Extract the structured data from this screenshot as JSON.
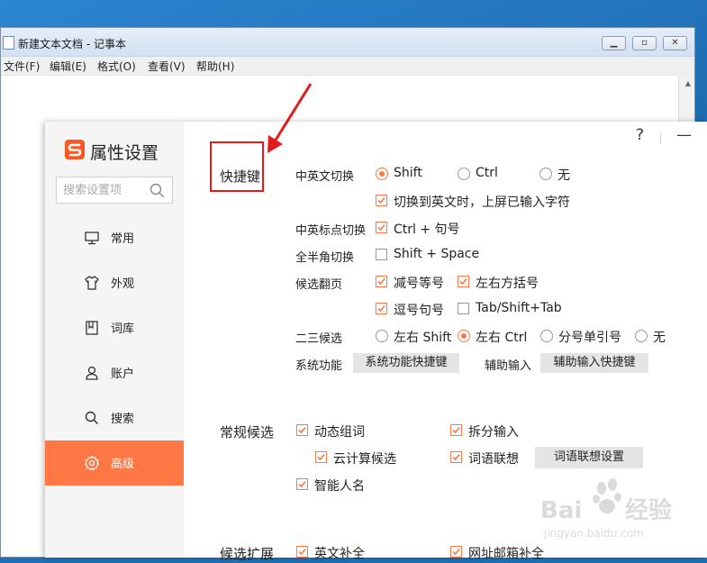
{
  "notepad": {
    "title": "新建文本文档 - 记事本",
    "menus": [
      "文件(F)",
      "编辑(E)",
      "格式(O)",
      "查看(V)",
      "帮助(H)"
    ]
  },
  "dialog": {
    "title": "属性设置",
    "search_placeholder": "搜索设置项",
    "help": "?",
    "minimize": "—",
    "nav": [
      {
        "label": "常用",
        "icon": "monitor-icon"
      },
      {
        "label": "外观",
        "icon": "shirt-icon"
      },
      {
        "label": "词库",
        "icon": "bookmark-icon"
      },
      {
        "label": "账户",
        "icon": "user-icon"
      },
      {
        "label": "搜索",
        "icon": "search-icon"
      },
      {
        "label": "高级",
        "icon": "gear-icon",
        "active": true
      }
    ]
  },
  "shortcuts": {
    "title": "快捷键",
    "cn_en_switch": {
      "label": "中英文切换",
      "options": [
        "Shift",
        "Ctrl",
        "无"
      ],
      "selected": "Shift",
      "commit_label": "切换到英文时，上屏已输入字符",
      "commit_checked": true
    },
    "punct_switch": {
      "label": "中英标点切换",
      "option": "Ctrl + 句号",
      "checked": true
    },
    "width_switch": {
      "label": "全半角切换",
      "option": "Shift + Space",
      "checked": false
    },
    "page_turn": {
      "label": "候选翻页",
      "options": [
        {
          "label": "减号等号",
          "checked": true
        },
        {
          "label": "左右方括号",
          "checked": true
        },
        {
          "label": "逗号句号",
          "checked": true
        },
        {
          "label": "Tab/Shift+Tab",
          "checked": false
        }
      ]
    },
    "second_third": {
      "label": "二三候选",
      "options": [
        "左右 Shift",
        "左右 Ctrl",
        "分号单引号",
        "无"
      ],
      "selected": "左右 Ctrl"
    },
    "system": {
      "label": "系统功能",
      "button": "系统功能快捷键"
    },
    "assist": {
      "label": "辅助输入",
      "button": "辅助输入快捷键"
    }
  },
  "candidates": {
    "title": "常规候选",
    "dynamic": "动态组词",
    "split": "拆分输入",
    "cloud": "云计算候选",
    "assoc": "词语联想",
    "assoc_button": "词语联想设置",
    "names": "智能人名"
  },
  "expansion": {
    "title": "候选扩展",
    "english": "英文补全",
    "url_mail": "网址邮箱补全"
  },
  "colors": {
    "accent": "#ff7744",
    "annotation": "#e21b1b"
  }
}
